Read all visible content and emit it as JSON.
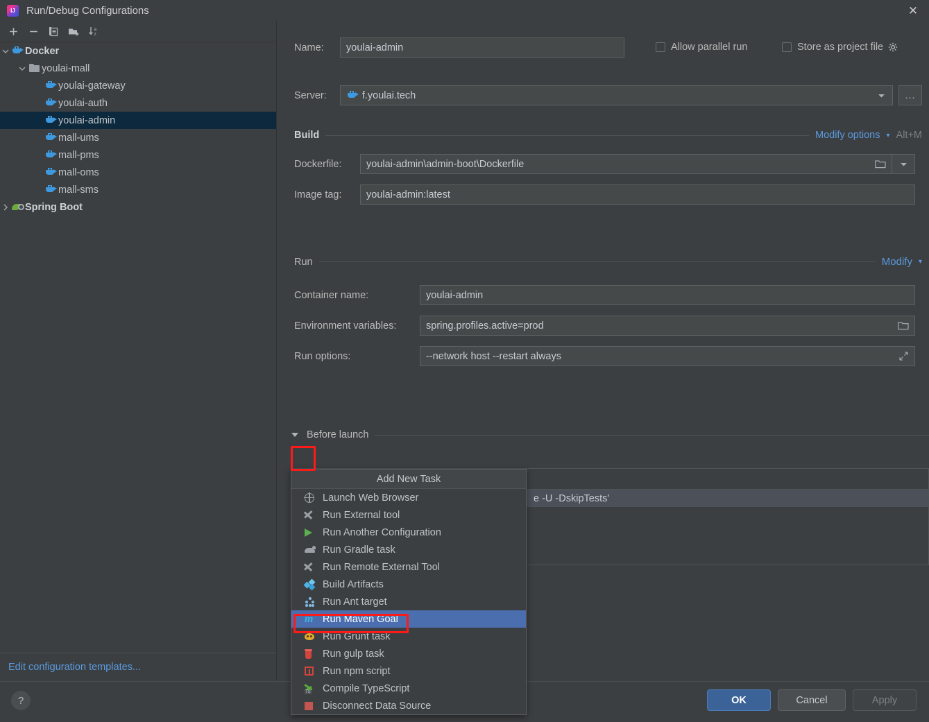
{
  "window": {
    "title": "Run/Debug Configurations",
    "app_icon": "intellij-idea-icon",
    "close_icon": "✕"
  },
  "sidebar": {
    "toolbar": [
      {
        "name": "add-configuration-button",
        "icon": "plus-icon"
      },
      {
        "name": "remove-configuration-button",
        "icon": "minus-icon"
      },
      {
        "name": "copy-configuration-button",
        "icon": "copy-icon"
      },
      {
        "name": "new-folder-button",
        "icon": "folder-add-icon"
      },
      {
        "name": "sort-configurations-button",
        "icon": "sort-alpha-icon"
      }
    ],
    "tree": [
      {
        "label": "Docker",
        "icon": "docker-icon",
        "depth": 0,
        "arrow": "expanded",
        "bold": true,
        "selected": false
      },
      {
        "label": "youlai-mall",
        "icon": "folder-icon",
        "depth": 1,
        "arrow": "expanded",
        "bold": false,
        "selected": false
      },
      {
        "label": "youlai-gateway",
        "icon": "docker-icon",
        "depth": 2,
        "arrow": "none",
        "bold": false,
        "selected": false
      },
      {
        "label": "youlai-auth",
        "icon": "docker-icon",
        "depth": 2,
        "arrow": "none",
        "bold": false,
        "selected": false
      },
      {
        "label": "youlai-admin",
        "icon": "docker-icon",
        "depth": 2,
        "arrow": "none",
        "bold": false,
        "selected": true
      },
      {
        "label": "mall-ums",
        "icon": "docker-icon",
        "depth": 2,
        "arrow": "none",
        "bold": false,
        "selected": false
      },
      {
        "label": "mall-pms",
        "icon": "docker-icon",
        "depth": 2,
        "arrow": "none",
        "bold": false,
        "selected": false
      },
      {
        "label": "mall-oms",
        "icon": "docker-icon",
        "depth": 2,
        "arrow": "none",
        "bold": false,
        "selected": false
      },
      {
        "label": "mall-sms",
        "icon": "docker-icon",
        "depth": 2,
        "arrow": "none",
        "bold": false,
        "selected": false
      },
      {
        "label": "Spring Boot",
        "icon": "spring-boot-icon",
        "depth": 0,
        "arrow": "collapsed",
        "bold": true,
        "selected": false
      }
    ],
    "edit_templates_link": "Edit configuration templates..."
  },
  "form": {
    "name_label": "Name:",
    "name_value": "youlai-admin",
    "allow_parallel_run_label": "Allow parallel run",
    "allow_parallel_run_checked": false,
    "store_as_project_file_label": "Store as project file",
    "store_as_project_file_checked": false,
    "store_gear_icon": "gear-icon",
    "server_label": "Server:",
    "server_value": "f.youlai.tech",
    "server_icon": "docker-icon",
    "server_dropdown_icon": "chevron-down-icon",
    "server_browse_label": "...",
    "build_section_title": "Build",
    "build_modify_options_link": "Modify options",
    "build_modify_options_hint": "Alt+M",
    "dockerfile_label": "Dockerfile:",
    "dockerfile_value": "youlai-admin\\admin-boot\\Dockerfile",
    "dockerfile_browse_icon": "folder-icon",
    "dockerfile_dropdown_icon": "chevron-down-icon",
    "image_tag_label": "Image tag:",
    "image_tag_value": "youlai-admin:latest",
    "run_section_title": "Run",
    "run_modify_link": "Modify",
    "container_name_label": "Container name:",
    "container_name_value": "youlai-admin",
    "env_vars_label": "Environment variables:",
    "env_vars_value": "spring.profiles.active=prod",
    "env_vars_browse_icon": "folder-icon",
    "run_options_label": "Run options:",
    "run_options_value": "--network host --restart always",
    "run_options_expand_icon": "expand-icon"
  },
  "before_launch": {
    "title": "Before launch",
    "collapse_icon": "triangle-down-icon",
    "toolbar": [
      {
        "name": "add-task-button",
        "icon": "plus-icon",
        "enabled": true
      },
      {
        "name": "remove-task-button",
        "icon": "minus-icon",
        "enabled": false
      },
      {
        "name": "edit-task-button",
        "icon": "pencil-icon",
        "enabled": false
      },
      {
        "name": "move-up-button",
        "icon": "triangle-up-icon",
        "enabled": false
      },
      {
        "name": "move-down-button",
        "icon": "triangle-down-icon",
        "enabled": false
      }
    ],
    "rows": [
      {
        "text": "e -U -DskipTests'"
      }
    ]
  },
  "task_menu": {
    "title": "Add New Task",
    "items": [
      {
        "label": "Launch Web Browser",
        "icon": "globe-icon",
        "selected": false
      },
      {
        "label": "Run External tool",
        "icon": "tools-icon",
        "selected": false
      },
      {
        "label": "Run Another Configuration",
        "icon": "play-icon",
        "selected": false
      },
      {
        "label": "Run Gradle task",
        "icon": "gradle-elephant-icon",
        "selected": false
      },
      {
        "label": "Run Remote External Tool",
        "icon": "tools-icon",
        "selected": false
      },
      {
        "label": "Build Artifacts",
        "icon": "artifacts-icon",
        "selected": false
      },
      {
        "label": "Run Ant target",
        "icon": "ant-icon",
        "selected": false
      },
      {
        "label": "Run Maven Goal",
        "icon": "maven-icon",
        "selected": true
      },
      {
        "label": "Run Grunt task",
        "icon": "grunt-icon",
        "selected": false
      },
      {
        "label": "Run gulp task",
        "icon": "gulp-icon",
        "selected": false
      },
      {
        "label": "Run npm script",
        "icon": "npm-icon",
        "selected": false
      },
      {
        "label": "Compile TypeScript",
        "icon": "typescript-icon",
        "selected": false
      },
      {
        "label": "Disconnect Data Source",
        "icon": "data-source-icon",
        "selected": false
      }
    ]
  },
  "footer": {
    "help_label": "?",
    "ok_label": "OK",
    "cancel_label": "Cancel",
    "apply_label": "Apply"
  },
  "colors": {
    "dialog_bg": "#3c3f41",
    "field_bg": "#45494a",
    "accent_link": "#5a9ae0",
    "selection_blue": "#4b6eaf",
    "tree_selection": "#0d293e",
    "annotation_red": "#ff1a1a",
    "ok_button": "#3c6398"
  }
}
